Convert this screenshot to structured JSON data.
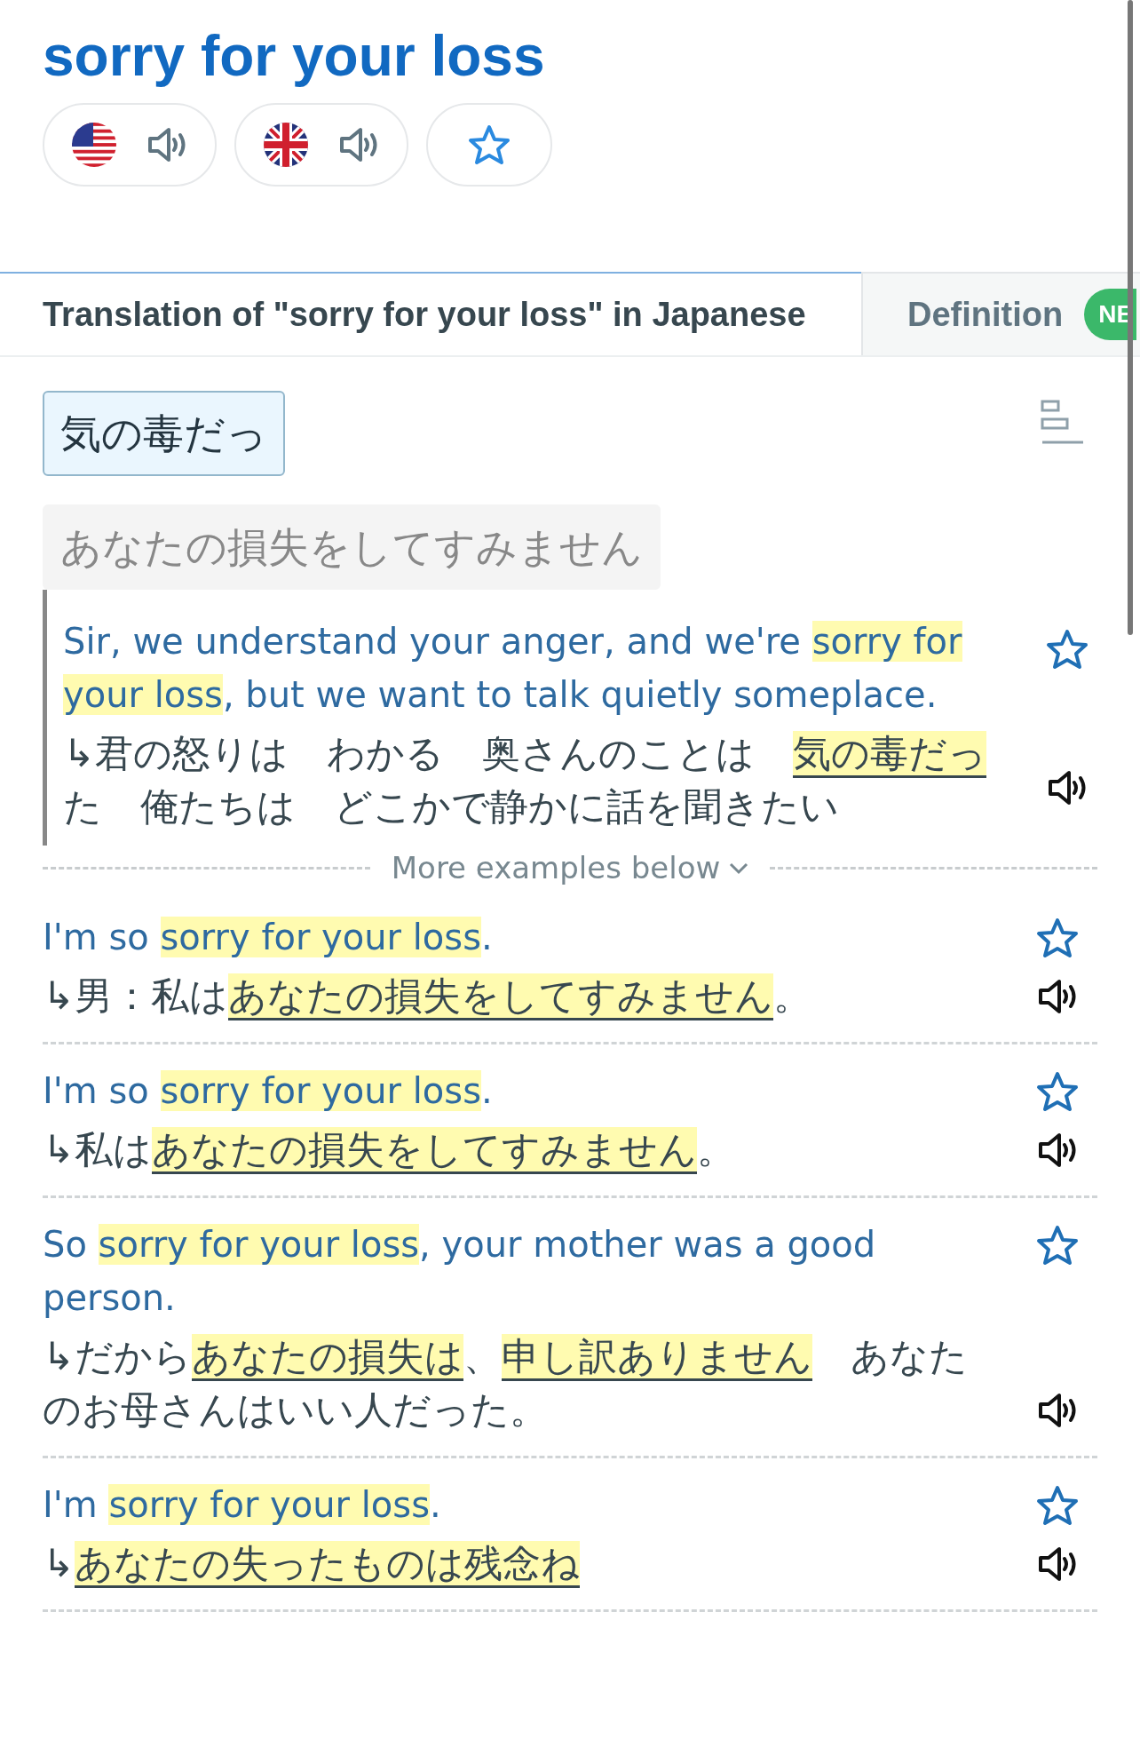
{
  "header": {
    "title": "sorry for your loss",
    "buttons": [
      {
        "kind": "american"
      },
      {
        "kind": "british"
      },
      {
        "kind": "favorite"
      }
    ]
  },
  "tabs": [
    {
      "label": "Translation of \"sorry for your loss\" in Japanese",
      "selected": true
    },
    {
      "label": "Definition",
      "selected": false,
      "badge": "NE"
    }
  ],
  "translations": [
    {
      "text": "気の毒だっ",
      "selected": true
    },
    {
      "text": "あなたの損失をしてすみません",
      "selected": false
    }
  ],
  "featured_example": {
    "source": [
      {
        "text": "Sir, we understand your anger, and we're "
      },
      {
        "text": "sorry for your loss",
        "highlight": true
      },
      {
        "text": ", but we want to talk quietly someplace."
      }
    ],
    "target": [
      {
        "text": "↳君の怒りは　わかる　奥さんのことは　"
      },
      {
        "text": "気の毒だっ",
        "highlight": true
      },
      {
        "text": "た　俺たちは　どこかで静かに話を聞きたい"
      }
    ]
  },
  "more_label": "More examples below",
  "examples": [
    {
      "source": [
        {
          "text": "I'm so "
        },
        {
          "text": "sorry for your loss",
          "highlight": true
        },
        {
          "text": "."
        }
      ],
      "target": [
        {
          "text": "↳男：私は"
        },
        {
          "text": "あなたの損失をしてすみません",
          "highlight": true
        },
        {
          "text": "。"
        }
      ]
    },
    {
      "source": [
        {
          "text": "I'm so "
        },
        {
          "text": "sorry for your loss",
          "highlight": true
        },
        {
          "text": "."
        }
      ],
      "target": [
        {
          "text": "↳私は"
        },
        {
          "text": "あなたの損失をしてすみません",
          "highlight": true
        },
        {
          "text": "。"
        }
      ]
    },
    {
      "source": [
        {
          "text": "So "
        },
        {
          "text": "sorry for your loss",
          "highlight": true
        },
        {
          "text": ", your mother was a good person."
        }
      ],
      "target": [
        {
          "text": "↳だから"
        },
        {
          "text": "あなたの損失は",
          "highlight": true
        },
        {
          "text": "、"
        },
        {
          "text": "申し訳ありません",
          "highlight": true
        },
        {
          "text": "　あなたのお母さんはいい人だった。"
        }
      ]
    },
    {
      "source": [
        {
          "text": "I'm "
        },
        {
          "text": "sorry for your loss",
          "highlight": true
        },
        {
          "text": "."
        }
      ],
      "target": [
        {
          "text": "↳"
        },
        {
          "text": "あなたの失ったものは残念ね",
          "highlight": true
        }
      ]
    }
  ]
}
